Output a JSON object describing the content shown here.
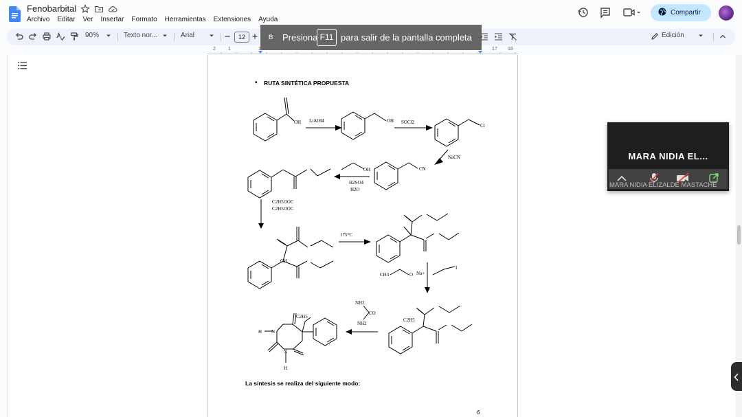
{
  "document": {
    "title": "Fenobarbital"
  },
  "menu": [
    "Archivo",
    "Editar",
    "Ver",
    "Insertar",
    "Formato",
    "Herramientas",
    "Extensiones",
    "Ayuda"
  ],
  "header": {
    "share_label": "Compartir"
  },
  "toolbar": {
    "zoom": "90%",
    "style": "Texto nor...",
    "font": "Arial",
    "font_size": "12",
    "mode": "Edición"
  },
  "ruler": {
    "ticks": [
      "2",
      "1",
      "1",
      "17",
      "18"
    ]
  },
  "banner": {
    "bold_label": "B",
    "prefix": "Presiona",
    "key": "F11",
    "suffix": "para salir de la pantalla completa"
  },
  "content": {
    "heading": "RUTA SINTÉTICA PROPUESTA",
    "caption": "La síntesis se realiza del siguiente modo:",
    "page_number": "6",
    "scheme_labels": {
      "oh1": "OH",
      "lialh4": "LiAlH4",
      "oh2": "OH",
      "socl2": "SOCl2",
      "cl": "Cl",
      "nacn": "NaCN",
      "cn": "CN",
      "oh3": "OH",
      "h2so4": "H2SO4",
      "h2o": "H2O",
      "c2h5ooc1": "C2H5OOC",
      "c2h5ooc2": "C2H5OOC",
      "temp": "175°C",
      "ch": "CH",
      "ch3": "CH3",
      "o_minus": "O",
      "na_plus": "Na+",
      "iodo": "I",
      "nh2_a": "NH2",
      "co": "CO",
      "nh2_b": "NH2",
      "c2h5_a": "C2H5",
      "c2h5_b": "C2H5",
      "h_a": "H",
      "n_a": "N",
      "n_b": "N",
      "h_b": "H"
    }
  },
  "video": {
    "name": "MARA NIDIA EL...",
    "fullname": "MARA NIDIA ELIZALDE MASTACHE"
  },
  "colors": {
    "accent": "#c2e7ff",
    "toolbar_bg": "#edf2fa",
    "docs_blue": "#4285f4"
  }
}
